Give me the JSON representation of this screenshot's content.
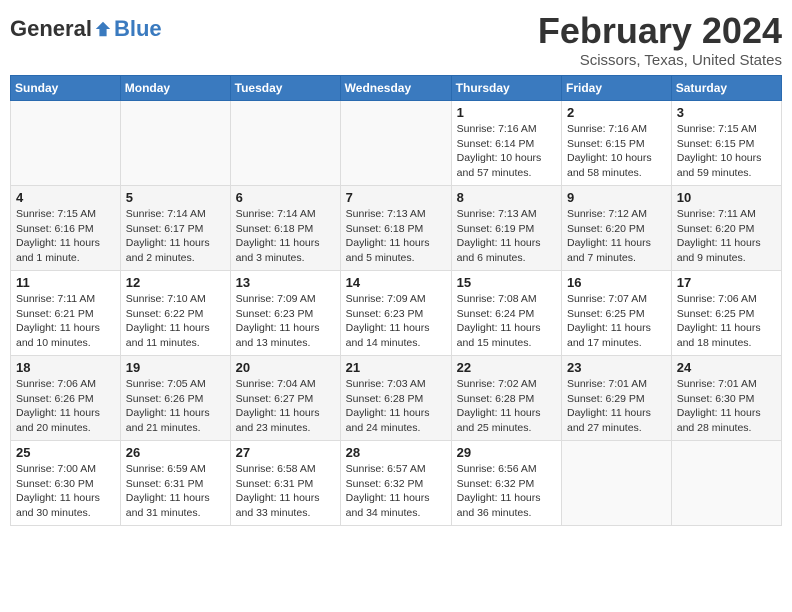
{
  "header": {
    "logo_general": "General",
    "logo_blue": "Blue",
    "month_title": "February 2024",
    "subtitle": "Scissors, Texas, United States"
  },
  "days_of_week": [
    "Sunday",
    "Monday",
    "Tuesday",
    "Wednesday",
    "Thursday",
    "Friday",
    "Saturday"
  ],
  "weeks": [
    [
      {
        "day": "",
        "info": ""
      },
      {
        "day": "",
        "info": ""
      },
      {
        "day": "",
        "info": ""
      },
      {
        "day": "",
        "info": ""
      },
      {
        "day": "1",
        "info": "Sunrise: 7:16 AM\nSunset: 6:14 PM\nDaylight: 10 hours\nand 57 minutes."
      },
      {
        "day": "2",
        "info": "Sunrise: 7:16 AM\nSunset: 6:15 PM\nDaylight: 10 hours\nand 58 minutes."
      },
      {
        "day": "3",
        "info": "Sunrise: 7:15 AM\nSunset: 6:15 PM\nDaylight: 10 hours\nand 59 minutes."
      }
    ],
    [
      {
        "day": "4",
        "info": "Sunrise: 7:15 AM\nSunset: 6:16 PM\nDaylight: 11 hours\nand 1 minute."
      },
      {
        "day": "5",
        "info": "Sunrise: 7:14 AM\nSunset: 6:17 PM\nDaylight: 11 hours\nand 2 minutes."
      },
      {
        "day": "6",
        "info": "Sunrise: 7:14 AM\nSunset: 6:18 PM\nDaylight: 11 hours\nand 3 minutes."
      },
      {
        "day": "7",
        "info": "Sunrise: 7:13 AM\nSunset: 6:18 PM\nDaylight: 11 hours\nand 5 minutes."
      },
      {
        "day": "8",
        "info": "Sunrise: 7:13 AM\nSunset: 6:19 PM\nDaylight: 11 hours\nand 6 minutes."
      },
      {
        "day": "9",
        "info": "Sunrise: 7:12 AM\nSunset: 6:20 PM\nDaylight: 11 hours\nand 7 minutes."
      },
      {
        "day": "10",
        "info": "Sunrise: 7:11 AM\nSunset: 6:20 PM\nDaylight: 11 hours\nand 9 minutes."
      }
    ],
    [
      {
        "day": "11",
        "info": "Sunrise: 7:11 AM\nSunset: 6:21 PM\nDaylight: 11 hours\nand 10 minutes."
      },
      {
        "day": "12",
        "info": "Sunrise: 7:10 AM\nSunset: 6:22 PM\nDaylight: 11 hours\nand 11 minutes."
      },
      {
        "day": "13",
        "info": "Sunrise: 7:09 AM\nSunset: 6:23 PM\nDaylight: 11 hours\nand 13 minutes."
      },
      {
        "day": "14",
        "info": "Sunrise: 7:09 AM\nSunset: 6:23 PM\nDaylight: 11 hours\nand 14 minutes."
      },
      {
        "day": "15",
        "info": "Sunrise: 7:08 AM\nSunset: 6:24 PM\nDaylight: 11 hours\nand 15 minutes."
      },
      {
        "day": "16",
        "info": "Sunrise: 7:07 AM\nSunset: 6:25 PM\nDaylight: 11 hours\nand 17 minutes."
      },
      {
        "day": "17",
        "info": "Sunrise: 7:06 AM\nSunset: 6:25 PM\nDaylight: 11 hours\nand 18 minutes."
      }
    ],
    [
      {
        "day": "18",
        "info": "Sunrise: 7:06 AM\nSunset: 6:26 PM\nDaylight: 11 hours\nand 20 minutes."
      },
      {
        "day": "19",
        "info": "Sunrise: 7:05 AM\nSunset: 6:26 PM\nDaylight: 11 hours\nand 21 minutes."
      },
      {
        "day": "20",
        "info": "Sunrise: 7:04 AM\nSunset: 6:27 PM\nDaylight: 11 hours\nand 23 minutes."
      },
      {
        "day": "21",
        "info": "Sunrise: 7:03 AM\nSunset: 6:28 PM\nDaylight: 11 hours\nand 24 minutes."
      },
      {
        "day": "22",
        "info": "Sunrise: 7:02 AM\nSunset: 6:28 PM\nDaylight: 11 hours\nand 25 minutes."
      },
      {
        "day": "23",
        "info": "Sunrise: 7:01 AM\nSunset: 6:29 PM\nDaylight: 11 hours\nand 27 minutes."
      },
      {
        "day": "24",
        "info": "Sunrise: 7:01 AM\nSunset: 6:30 PM\nDaylight: 11 hours\nand 28 minutes."
      }
    ],
    [
      {
        "day": "25",
        "info": "Sunrise: 7:00 AM\nSunset: 6:30 PM\nDaylight: 11 hours\nand 30 minutes."
      },
      {
        "day": "26",
        "info": "Sunrise: 6:59 AM\nSunset: 6:31 PM\nDaylight: 11 hours\nand 31 minutes."
      },
      {
        "day": "27",
        "info": "Sunrise: 6:58 AM\nSunset: 6:31 PM\nDaylight: 11 hours\nand 33 minutes."
      },
      {
        "day": "28",
        "info": "Sunrise: 6:57 AM\nSunset: 6:32 PM\nDaylight: 11 hours\nand 34 minutes."
      },
      {
        "day": "29",
        "info": "Sunrise: 6:56 AM\nSunset: 6:32 PM\nDaylight: 11 hours\nand 36 minutes."
      },
      {
        "day": "",
        "info": ""
      },
      {
        "day": "",
        "info": ""
      }
    ]
  ]
}
